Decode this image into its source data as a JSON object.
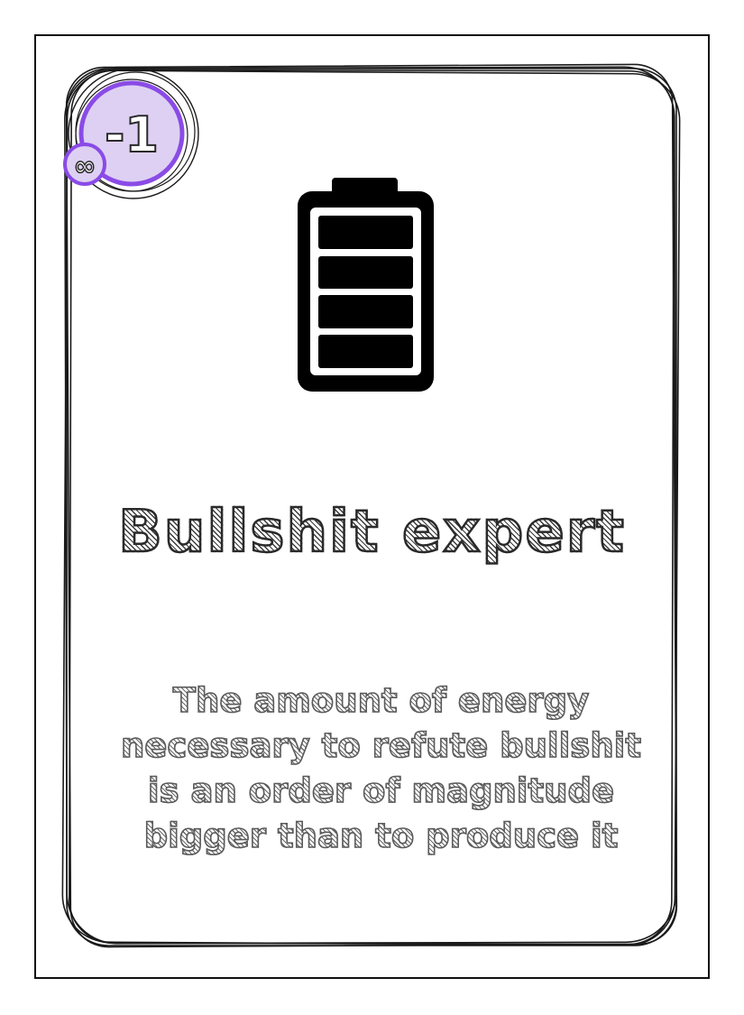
{
  "card": {
    "cost": "-1",
    "uses": "∞",
    "icon": "battery-full-icon",
    "title": "Bullshit expert",
    "description_lines": [
      "The amount of energy",
      "necessary to refute bullshit",
      "is an order of magnitude",
      "bigger than to produce it"
    ]
  },
  "colors": {
    "badge_fill": "#ded0f3",
    "badge_ring": "#8a4be6",
    "ink": "#111111"
  }
}
